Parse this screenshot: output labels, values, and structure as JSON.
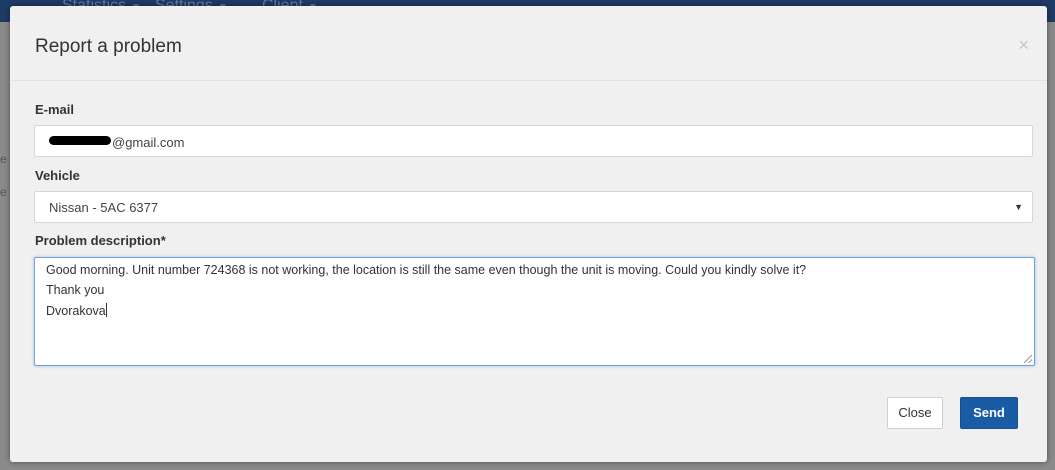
{
  "navbar": {
    "items": [
      {
        "label": "Statistics"
      },
      {
        "label": "Settings"
      },
      {
        "label": "Client"
      }
    ]
  },
  "modal": {
    "title": "Report a problem",
    "close_glyph": "×"
  },
  "form": {
    "email": {
      "label": "E-mail",
      "value_visible_suffix": "@gmail.com"
    },
    "vehicle": {
      "label": "Vehicle",
      "selected": "Nissan - 5AC 6377",
      "caret_glyph": "▼"
    },
    "description": {
      "label": "Problem description*",
      "lines": [
        "Good morning. Unit number 724368 is not working, the location is still the same even though the unit is moving. Could you kindly solve it?",
        "Thank you",
        "Dvorakova"
      ]
    }
  },
  "buttons": {
    "close_label": "Close",
    "send_label": "Send"
  },
  "colors": {
    "navbar": "#1e3a66",
    "modal_bg": "#f0f0f0",
    "primary": "#1a5ba6",
    "focus_border": "#6fa3d8"
  },
  "icons": {
    "close": "close-icon",
    "dropdown": "chevron-down-icon",
    "resize": "resize-grip-icon"
  }
}
